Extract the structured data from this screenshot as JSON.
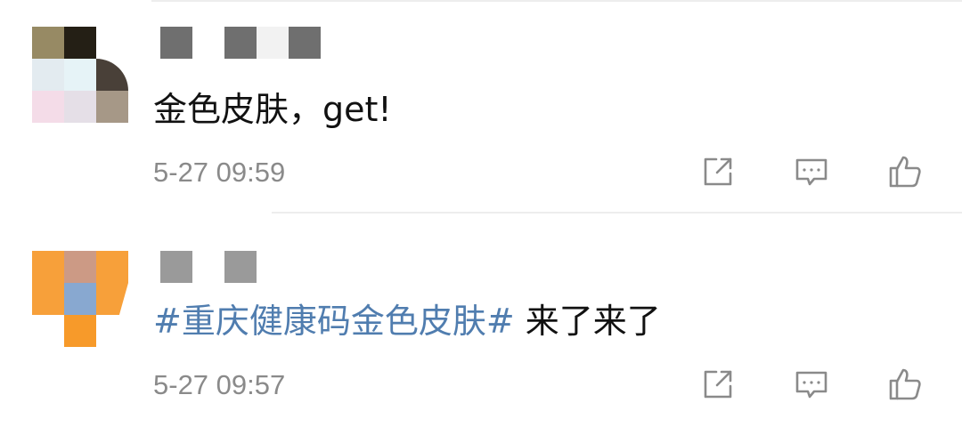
{
  "colors": {
    "text": "#111111",
    "hashtag": "#507daf",
    "meta": "#8a8a8a",
    "icon": "#8a8a8a",
    "divider": "#ededed",
    "mosaic": "#6f6f6f"
  },
  "comments": [
    {
      "text": "金色皮肤，get!",
      "time": "5-27 09:59",
      "avatar_mosaic_colors": [
        "#978a64",
        "#241f15",
        "#ffffff",
        "#e3ebf0",
        "#e6f3f7",
        "#494038",
        "#f4dce8",
        "#e5dfe7",
        "#a69887"
      ],
      "actions": [
        "share-icon",
        "comment-icon",
        "like-icon"
      ]
    },
    {
      "hashtag": "#重庆健康码金色皮肤#",
      "text": " 来了来了",
      "time": "5-27 09:57",
      "avatar_mosaic_colors": [
        "#f7a03a",
        "#cc9a85",
        "#f7a03a",
        "#ffffff",
        "#88a8d0",
        "#ffffff",
        "#ffffff",
        "#f79a2a",
        "#ffffff"
      ],
      "actions": [
        "share-icon",
        "comment-icon",
        "like-icon"
      ]
    }
  ]
}
